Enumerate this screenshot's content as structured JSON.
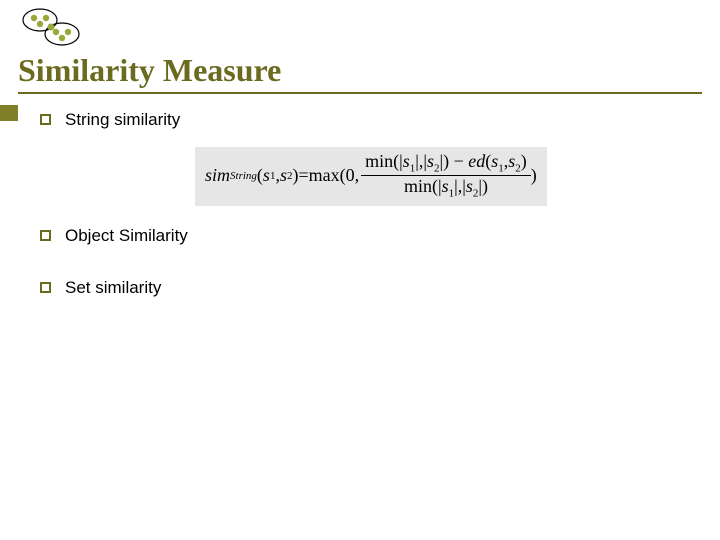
{
  "title": "Similarity Measure",
  "bullets": {
    "b1": "String similarity",
    "b2": "Object Similarity",
    "b3": "Set similarity"
  },
  "formula": {
    "lhs_func": "sim",
    "lhs_subscript": "String",
    "lhs_args_open": "(",
    "s1": "s",
    "one": "1",
    "comma": ",",
    "s2": "s",
    "two": "2",
    "lhs_args_close": ")",
    "eq": " = ",
    "max": "max",
    "open": "(",
    "zero": "0",
    "num_min": "min",
    "abs_open": "|",
    "abs_close": "|",
    "minus": " − ",
    "ed": "ed",
    "den_min": "min",
    "close": ")"
  }
}
